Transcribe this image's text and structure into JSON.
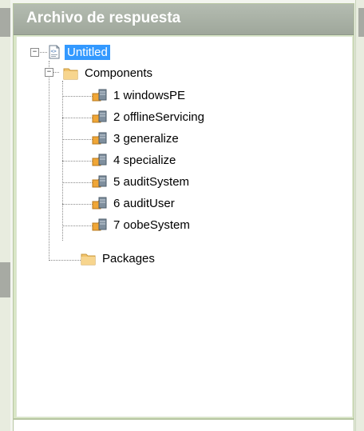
{
  "pane": {
    "title": "Archivo de respuesta"
  },
  "tree": {
    "root": {
      "label": "Untitled",
      "expander": "−",
      "selected": true
    },
    "components": {
      "label": "Components",
      "expander": "−"
    },
    "passes": [
      {
        "label": "1 windowsPE"
      },
      {
        "label": "2 offlineServicing"
      },
      {
        "label": "3 generalize"
      },
      {
        "label": "4 specialize"
      },
      {
        "label": "5 auditSystem"
      },
      {
        "label": "6 auditUser"
      },
      {
        "label": "7 oobeSystem"
      }
    ],
    "packages": {
      "label": "Packages"
    }
  },
  "icons": {
    "answer_file": "answer-file-icon",
    "folder": "folder-icon",
    "config_pass": "configuration-pass-icon"
  },
  "colors": {
    "header_bg": "#a9b1a5",
    "selection": "#3399ff",
    "pane_border": "#b7c6a2",
    "folder": "#f2c36b"
  }
}
